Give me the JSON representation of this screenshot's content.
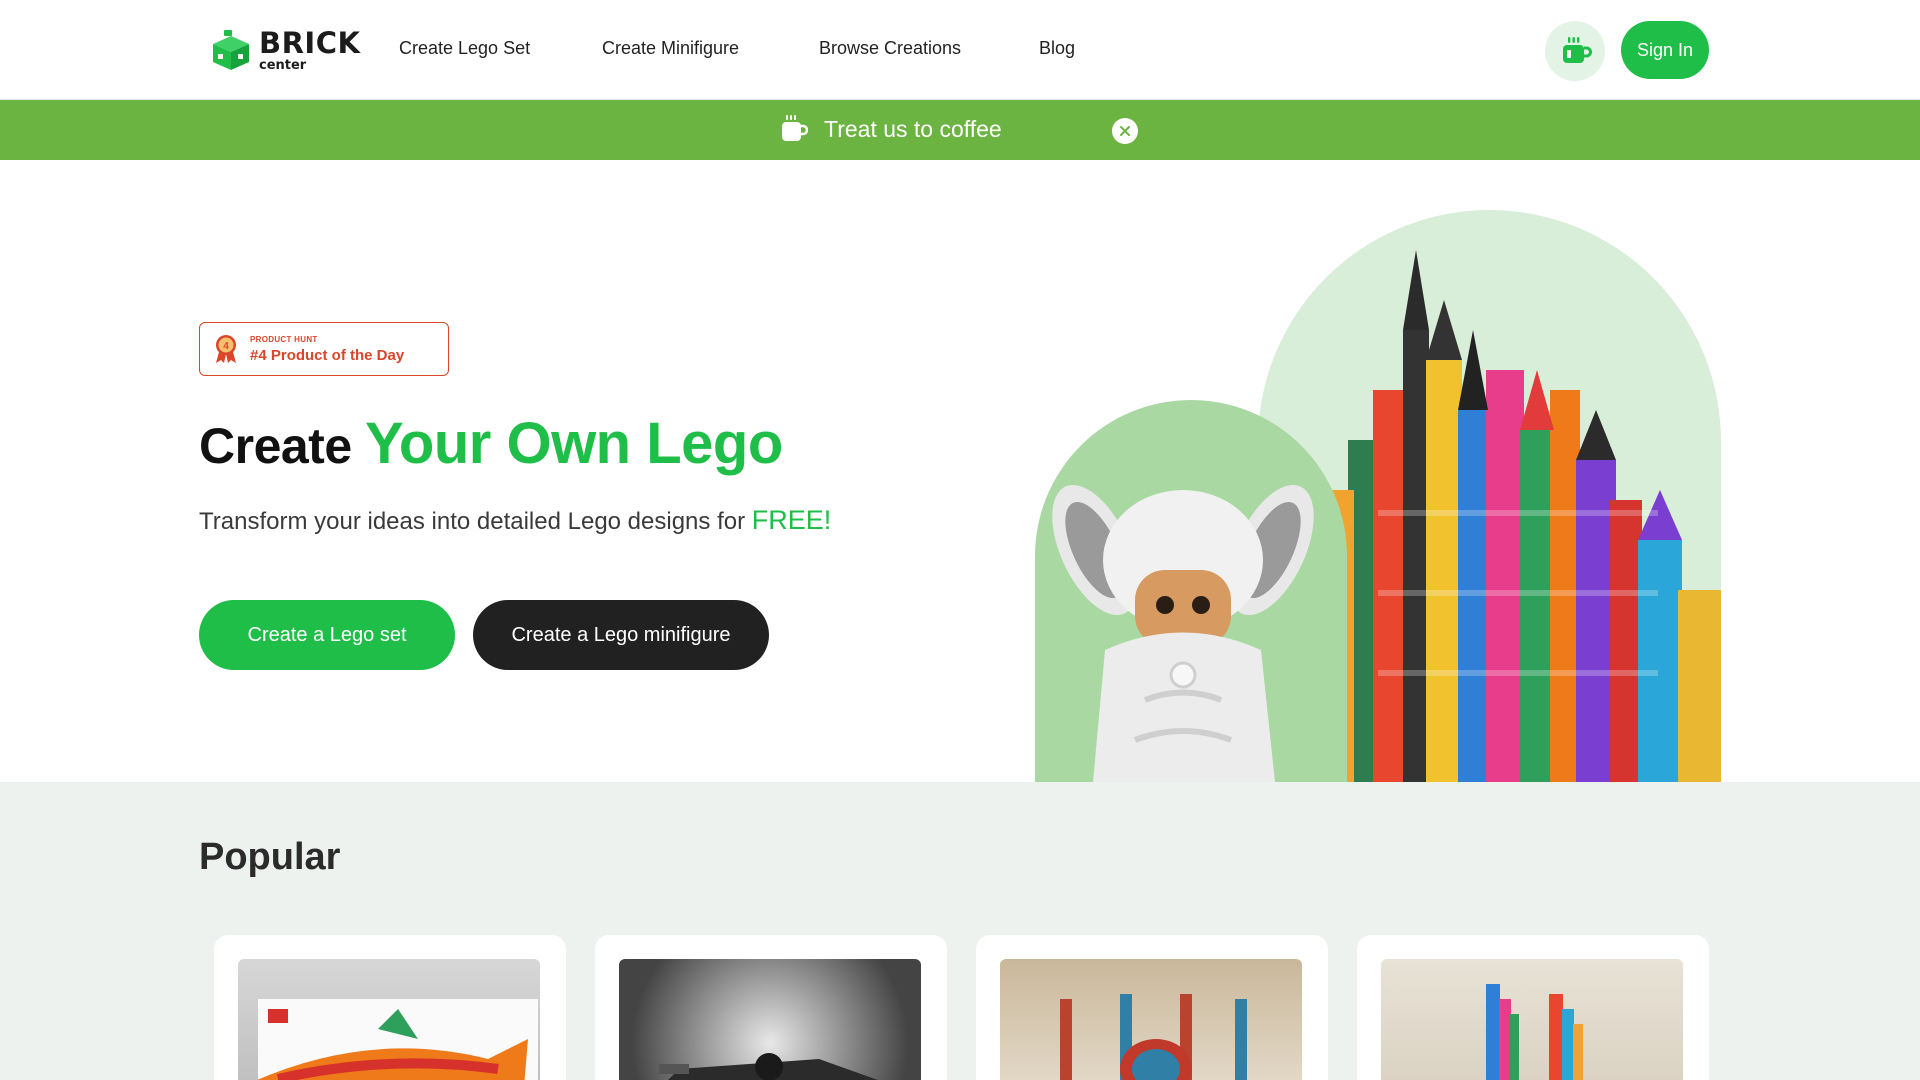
{
  "header": {
    "logo_main": "BRICK",
    "logo_sub": "center",
    "nav": [
      "Create Lego Set",
      "Create Minifigure",
      "Browse Creations",
      "Blog"
    ],
    "coffee_icon": "coffee-cup-icon",
    "signin_label": "Sign In"
  },
  "banner": {
    "icon": "coffee-cup-icon",
    "text": "Treat us to coffee",
    "close_icon": "close-icon"
  },
  "hero": {
    "badge_small": "PRODUCT HUNT",
    "badge_big": "#4 Product of the Day",
    "title_prefix": "Create ",
    "title_accent": "Your Own Lego",
    "subtitle_prefix": "Transform your ideas into detailed Lego designs for ",
    "subtitle_accent": "FREE!",
    "btn_primary": "Create a Lego set",
    "btn_secondary": "Create a Lego minifigure"
  },
  "popular": {
    "title": "Popular"
  },
  "colors": {
    "brand_green": "#1fbe48",
    "banner_green": "#6cb442",
    "dark_button": "#212121",
    "product_hunt": "#d9462a"
  }
}
